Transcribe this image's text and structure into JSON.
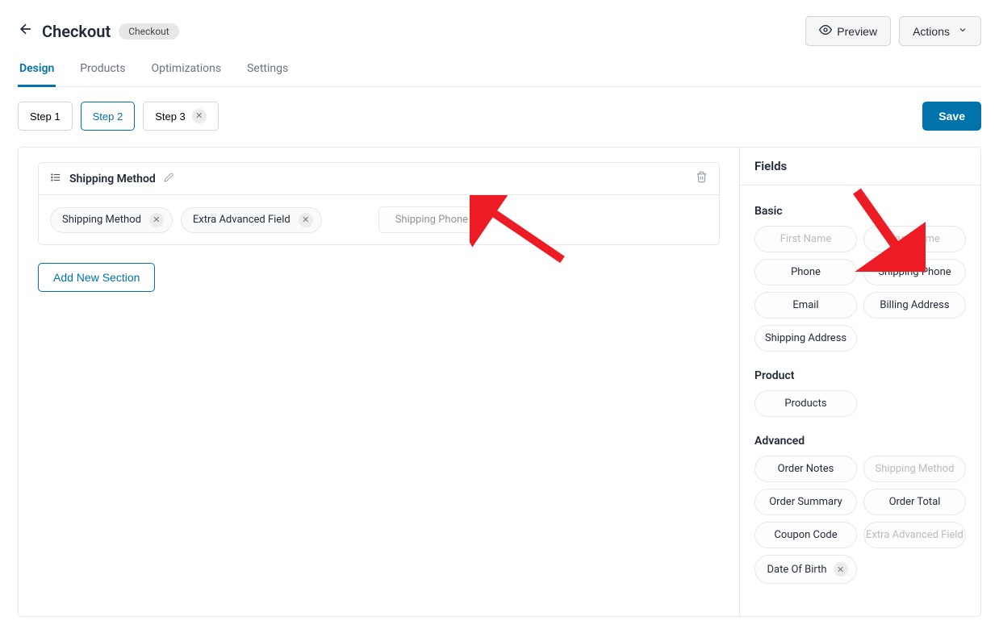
{
  "header": {
    "title": "Checkout",
    "badge": "Checkout",
    "preview": "Preview",
    "actions": "Actions"
  },
  "tabs": [
    "Design",
    "Products",
    "Optimizations",
    "Settings"
  ],
  "activeTab": 0,
  "steps": [
    {
      "label": "Step 1",
      "closable": false,
      "active": false
    },
    {
      "label": "Step 2",
      "closable": false,
      "active": true
    },
    {
      "label": "Step 3",
      "closable": true,
      "active": false
    }
  ],
  "saveLabel": "Save",
  "section": {
    "title": "Shipping Method",
    "chips": [
      "Shipping Method",
      "Extra Advanced Field"
    ],
    "ghost": "Shipping Phone"
  },
  "addSection": "Add New Section",
  "fieldsPanel": {
    "title": "Fields",
    "groups": [
      {
        "label": "Basic",
        "items": [
          {
            "label": "First Name",
            "disabled": true
          },
          {
            "label": "Last Name",
            "disabled": true
          },
          {
            "label": "Phone",
            "disabled": false
          },
          {
            "label": "Shipping Phone",
            "disabled": false
          },
          {
            "label": "Email",
            "disabled": false
          },
          {
            "label": "Billing Address",
            "disabled": false
          },
          {
            "label": "Shipping Address",
            "disabled": false
          }
        ]
      },
      {
        "label": "Product",
        "items": [
          {
            "label": "Products",
            "disabled": false
          }
        ]
      },
      {
        "label": "Advanced",
        "items": [
          {
            "label": "Order Notes",
            "disabled": false
          },
          {
            "label": "Shipping Method",
            "disabled": true
          },
          {
            "label": "Order Summary",
            "disabled": false
          },
          {
            "label": "Order Total",
            "disabled": false
          },
          {
            "label": "Coupon Code",
            "disabled": false
          },
          {
            "label": "Extra Advanced Field",
            "disabled": true
          },
          {
            "label": "Date Of Birth",
            "disabled": false,
            "closable": true
          }
        ]
      }
    ]
  }
}
